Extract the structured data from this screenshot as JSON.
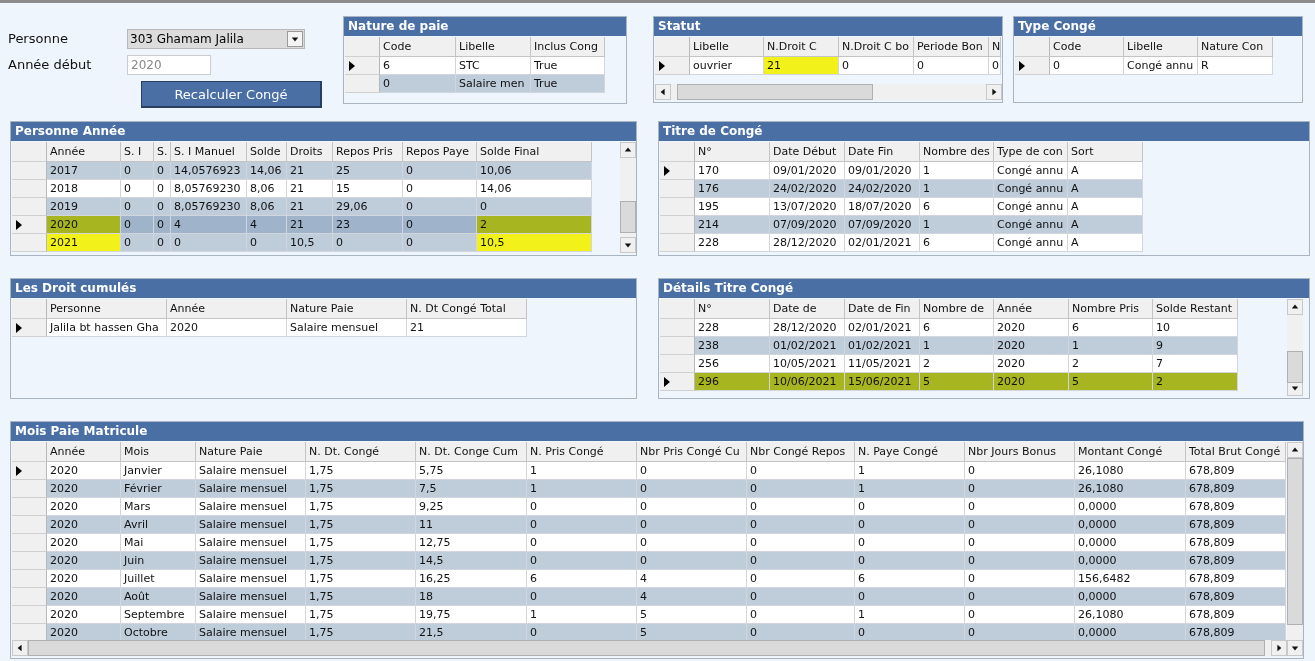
{
  "form": {
    "personne_label": "Personne",
    "personne_value": "303 Ghamam Jalila",
    "annee_label": "Année début",
    "annee_value": "2020",
    "recalc_button": "Recalculer Congé"
  },
  "grids": [
    {
      "kind": "nature",
      "title": "Nature de paie",
      "columns": [
        "Code",
        "Libelle",
        "Inclus Cong"
      ],
      "rows": [
        {
          "current": true,
          "selected": false,
          "shaded": false,
          "cells": [
            "6",
            "STC",
            "True"
          ]
        },
        {
          "current": false,
          "selected": false,
          "shaded": true,
          "cells": [
            "0",
            "Salaire men",
            "True"
          ]
        }
      ]
    },
    {
      "kind": "statut",
      "title": "Statut",
      "columns": [
        "Libelle",
        "N.Droit C",
        "N.Droit C bo",
        "Periode Bon",
        "N"
      ],
      "rows": [
        {
          "current": true,
          "selected": false,
          "shaded": false,
          "cells": [
            "ouvrier",
            {
              "text": "21",
              "marked": true
            },
            "0",
            "0",
            "0"
          ]
        }
      ]
    },
    {
      "kind": "type",
      "title": "Type Congé",
      "columns": [
        "Code",
        "Libelle",
        "Nature Con"
      ],
      "rows": [
        {
          "current": true,
          "selected": false,
          "shaded": false,
          "cells": [
            "0",
            "Congé annu",
            "R"
          ]
        }
      ]
    },
    {
      "kind": "personne",
      "title": "Personne Année",
      "columns": [
        "Année",
        "S. I",
        "S.",
        "S. I Manuel",
        "Solde",
        "Droits",
        "Repos Pris",
        "Repos Paye",
        "Solde Final"
      ],
      "rows": [
        {
          "current": false,
          "selected": false,
          "shaded": true,
          "cells": [
            "2017",
            "0",
            "0",
            "14,0576923",
            "14,06",
            "21",
            "25",
            "0",
            "10,06"
          ]
        },
        {
          "current": false,
          "selected": false,
          "shaded": false,
          "cells": [
            "2018",
            "0",
            "0",
            "8,05769230",
            "8,06",
            "21",
            "15",
            "0",
            "14,06"
          ]
        },
        {
          "current": false,
          "selected": false,
          "shaded": true,
          "cells": [
            "2019",
            "0",
            "0",
            "8,05769230",
            "8,06",
            "21",
            "29,06",
            "0",
            "0"
          ]
        },
        {
          "current": true,
          "selected": true,
          "shaded": false,
          "cells": [
            {
              "text": "2020",
              "marked": true
            },
            "0",
            "0",
            "4",
            "4",
            "21",
            "23",
            "0",
            {
              "text": "2",
              "marked": true
            }
          ]
        },
        {
          "current": false,
          "selected": false,
          "shaded": true,
          "cells": [
            {
              "text": "2021",
              "marked": true
            },
            "0",
            "0",
            "0",
            "0",
            "10,5",
            "0",
            "0",
            {
              "text": "10,5",
              "marked": true
            }
          ]
        }
      ]
    },
    {
      "kind": "titre",
      "title": "Titre de Congé",
      "columns": [
        "N°",
        "Date Début",
        "Date Fin",
        "Nombre des",
        "Type de con",
        "Sort"
      ],
      "rows": [
        {
          "current": true,
          "selected": false,
          "shaded": false,
          "cells": [
            "170",
            "09/01/2020",
            "09/01/2020",
            "1",
            "Congé annu",
            "A"
          ]
        },
        {
          "current": false,
          "selected": false,
          "shaded": true,
          "cells": [
            "176",
            "24/02/2020",
            "24/02/2020",
            "1",
            "Congé annu",
            "A"
          ]
        },
        {
          "current": false,
          "selected": false,
          "shaded": false,
          "cells": [
            "195",
            "13/07/2020",
            "18/07/2020",
            "6",
            "Congé annu",
            "A"
          ]
        },
        {
          "current": false,
          "selected": false,
          "shaded": true,
          "cells": [
            "214",
            "07/09/2020",
            "07/09/2020",
            "1",
            "Congé annu",
            "A"
          ]
        },
        {
          "current": false,
          "selected": false,
          "shaded": false,
          "cells": [
            "228",
            "28/12/2020",
            "02/01/2021",
            "6",
            "Congé annu",
            "A"
          ]
        }
      ]
    },
    {
      "kind": "droit",
      "title": "Les Droit cumulés",
      "columns": [
        "Personne",
        "Année",
        "Nature Paie",
        "N. Dt Congé Total"
      ],
      "rows": [
        {
          "current": true,
          "selected": false,
          "shaded": false,
          "cells": [
            "Jalila bt hassen Gha",
            "2020",
            "Salaire mensuel",
            "21"
          ]
        }
      ]
    },
    {
      "kind": "details",
      "title": "Détails Titre Congé",
      "columns": [
        "N°",
        "Date de",
        "Date de Fin",
        "Nombre de",
        "Année",
        "Nombre Pris",
        "Solde Restant"
      ],
      "rows": [
        {
          "current": false,
          "selected": false,
          "shaded": false,
          "cells": [
            "228",
            "28/12/2020",
            "02/01/2021",
            "6",
            "2020",
            "6",
            "10"
          ]
        },
        {
          "current": false,
          "selected": false,
          "shaded": true,
          "cells": [
            "238",
            "01/02/2021",
            "01/02/2021",
            "1",
            "2020",
            "1",
            "9"
          ]
        },
        {
          "current": false,
          "selected": false,
          "shaded": false,
          "cells": [
            "256",
            "10/05/2021",
            "11/05/2021",
            "2",
            "2020",
            "2",
            "7"
          ]
        },
        {
          "current": true,
          "selected": true,
          "shaded": false,
          "cells": [
            {
              "text": "296",
              "marked": true
            },
            {
              "text": "10/06/2021",
              "marked": true
            },
            {
              "text": "15/06/2021",
              "marked": true
            },
            {
              "text": "5",
              "marked": true
            },
            {
              "text": "2020",
              "marked": true
            },
            {
              "text": "5",
              "marked": true
            },
            {
              "text": "2",
              "marked": true
            }
          ]
        }
      ]
    },
    {
      "kind": "mois",
      "title": "Mois Paie Matricule",
      "columns": [
        "Année",
        "Mois",
        "Nature Paie",
        "N. Dt. Congé",
        "N. Dt. Conge Cum",
        "N. Pris Congé",
        "Nbr Pris Congé Cu",
        "Nbr Congé Repos",
        "N. Paye Congé",
        "Nbr Jours Bonus",
        "Montant Congé",
        "Total Brut Congé"
      ],
      "rows": [
        {
          "current": true,
          "selected": false,
          "shaded": false,
          "cells": [
            "2020",
            "Janvier",
            "Salaire mensuel",
            "1,75",
            "5,75",
            "1",
            "0",
            "0",
            "1",
            "0",
            "26,1080",
            "678,809"
          ]
        },
        {
          "current": false,
          "selected": false,
          "shaded": true,
          "cells": [
            "2020",
            "Février",
            "Salaire mensuel",
            "1,75",
            "7,5",
            "1",
            "0",
            "0",
            "1",
            "0",
            "26,1080",
            "678,809"
          ]
        },
        {
          "current": false,
          "selected": false,
          "shaded": false,
          "cells": [
            "2020",
            "Mars",
            "Salaire mensuel",
            "1,75",
            "9,25",
            "0",
            "0",
            "0",
            "0",
            "0",
            "0,0000",
            "678,809"
          ]
        },
        {
          "current": false,
          "selected": false,
          "shaded": true,
          "cells": [
            "2020",
            "Avril",
            "Salaire mensuel",
            "1,75",
            "11",
            "0",
            "0",
            "0",
            "0",
            "0",
            "0,0000",
            "678,809"
          ]
        },
        {
          "current": false,
          "selected": false,
          "shaded": false,
          "cells": [
            "2020",
            "Mai",
            "Salaire mensuel",
            "1,75",
            "12,75",
            "0",
            "0",
            "0",
            "0",
            "0",
            "0,0000",
            "678,809"
          ]
        },
        {
          "current": false,
          "selected": false,
          "shaded": true,
          "cells": [
            "2020",
            "Juin",
            "Salaire mensuel",
            "1,75",
            "14,5",
            "0",
            "0",
            "0",
            "0",
            "0",
            "0,0000",
            "678,809"
          ]
        },
        {
          "current": false,
          "selected": false,
          "shaded": false,
          "cells": [
            "2020",
            "Juillet",
            "Salaire mensuel",
            "1,75",
            "16,25",
            "6",
            "4",
            "0",
            "6",
            "0",
            "156,6482",
            "678,809"
          ]
        },
        {
          "current": false,
          "selected": false,
          "shaded": true,
          "cells": [
            "2020",
            "Août",
            "Salaire mensuel",
            "1,75",
            "18",
            "0",
            "4",
            "0",
            "0",
            "0",
            "0,0000",
            "678,809"
          ]
        },
        {
          "current": false,
          "selected": false,
          "shaded": false,
          "cells": [
            "2020",
            "Septembre",
            "Salaire mensuel",
            "1,75",
            "19,75",
            "1",
            "5",
            "0",
            "1",
            "0",
            "26,1080",
            "678,809"
          ]
        },
        {
          "current": false,
          "selected": false,
          "shaded": true,
          "cells": [
            "2020",
            "Octobre",
            "Salaire mensuel",
            "1,75",
            "21,5",
            "0",
            "5",
            "0",
            "0",
            "0",
            "0,0000",
            "678,809"
          ]
        }
      ]
    }
  ]
}
